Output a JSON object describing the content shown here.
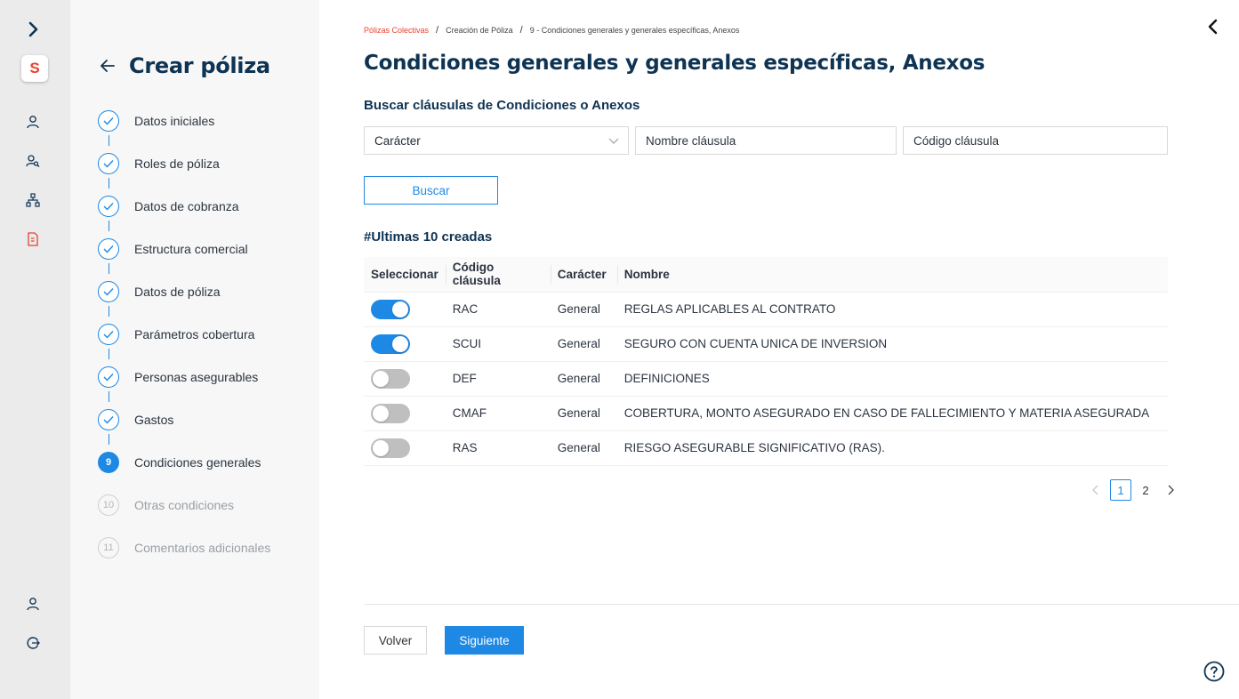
{
  "colors": {
    "accent": "#1e88e5",
    "brand": "#e8412f",
    "title": "#0e3353",
    "rail_bg": "#ebebeb",
    "panel_bg": "#f7f7f7"
  },
  "rail": {
    "logo": "S",
    "icons": [
      "expand-chevron-icon",
      "user-icon",
      "users-search-icon",
      "org-chart-icon",
      "document-icon",
      "profile-icon",
      "logout-icon"
    ]
  },
  "stepper": {
    "title": "Crear póliza",
    "steps": [
      {
        "number": "1",
        "label": "Datos iniciales",
        "status": "done"
      },
      {
        "number": "2",
        "label": "Roles de póliza",
        "status": "done"
      },
      {
        "number": "3",
        "label": "Datos de cobranza",
        "status": "done"
      },
      {
        "number": "4",
        "label": "Estructura comercial",
        "status": "done"
      },
      {
        "number": "5",
        "label": "Datos de póliza",
        "status": "done"
      },
      {
        "number": "6",
        "label": "Parámetros cobertura",
        "status": "done"
      },
      {
        "number": "7",
        "label": "Personas asegurables",
        "status": "done"
      },
      {
        "number": "8",
        "label": "Gastos",
        "status": "done"
      },
      {
        "number": "9",
        "label": "Condiciones generales",
        "status": "active"
      },
      {
        "number": "10",
        "label": "Otras condiciones",
        "status": "todo"
      },
      {
        "number": "11",
        "label": "Comentarios adicionales",
        "status": "todo"
      }
    ]
  },
  "breadcrumb": {
    "items": [
      "Pólizas Colectivas",
      "Creación de Póliza",
      "9 - Condiciones generales y generales específicas, Anexos"
    ],
    "separator": "/"
  },
  "page": {
    "title": "Condiciones generales y generales específicas, Anexos",
    "search_title": "Buscar cláusulas de Condiciones o Anexos",
    "filters": {
      "caracter_placeholder": "Carácter",
      "nombre_placeholder": "Nombre cláusula",
      "codigo_placeholder": "Código cláusula"
    },
    "search_button": "Buscar",
    "recent_title": "#Ultimas 10 creadas"
  },
  "table": {
    "headers": [
      "Seleccionar",
      "Código cláusula",
      "Carácter",
      "Nombre"
    ],
    "rows": [
      {
        "selected": true,
        "codigo": "RAC",
        "caracter": "General",
        "nombre": "REGLAS APLICABLES AL CONTRATO"
      },
      {
        "selected": true,
        "codigo": "SCUI",
        "caracter": "General",
        "nombre": "SEGURO CON CUENTA UNICA DE INVERSION"
      },
      {
        "selected": false,
        "codigo": "DEF",
        "caracter": "General",
        "nombre": "DEFINICIONES"
      },
      {
        "selected": false,
        "codigo": "CMAF",
        "caracter": "General",
        "nombre": "COBERTURA, MONTO ASEGURADO EN CASO DE FALLECIMIENTO Y MATERIA ASEGURADA"
      },
      {
        "selected": false,
        "codigo": "RAS",
        "caracter": "General",
        "nombre": "RIESGO ASEGURABLE SIGNIFICATIVO (RAS)."
      }
    ]
  },
  "pagination": {
    "pages": [
      "1",
      "2"
    ],
    "current": "1"
  },
  "footer": {
    "back_label": "Volver",
    "next_label": "Siguiente"
  }
}
